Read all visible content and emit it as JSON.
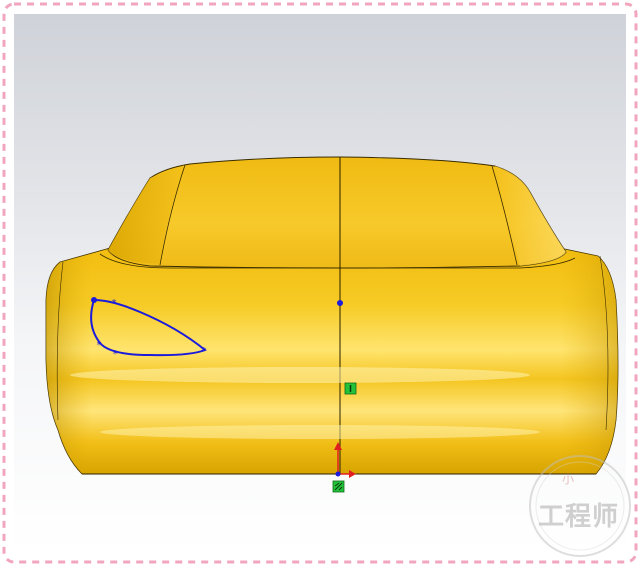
{
  "colors": {
    "border_dash": "#f2a6bd",
    "border_fill": "#fde8ef",
    "body_light": "#ffe36a",
    "body_mid": "#f3c21a",
    "body_dark": "#c99a00",
    "sketch_blue": "#1b1bdc",
    "origin_red": "#e02020",
    "marker_green": "#23c23a"
  },
  "icons": {
    "sketch_point": "sketch-point-icon",
    "origin": "origin-icon",
    "relation_vertical": "vertical-relation-icon",
    "relation_fix": "fix-relation-icon"
  },
  "watermark": {
    "main": "工程师",
    "small": "小"
  }
}
